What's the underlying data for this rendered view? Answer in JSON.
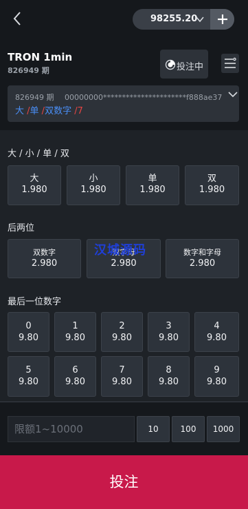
{
  "topbar": {
    "balance": "98255.20",
    "plus_label": "+"
  },
  "header": {
    "title": "TRON 1min",
    "period": "826949 期",
    "bet_status": "投注中"
  },
  "result": {
    "period": "826949 期",
    "hash": "00000000**********************f888ae37",
    "size": "大",
    "sep1": " /",
    "oddeven": "单",
    "sep2": " /",
    "type": "双数字",
    "sep3": " /",
    "digit": "7"
  },
  "sections": {
    "bigsmall_title": "大 / 小 / 单 / 双",
    "last2_title": "后两位",
    "lastdigit_title": "最后一位数字"
  },
  "bigsmall": [
    {
      "name": "大",
      "odds": "1.980"
    },
    {
      "name": "小",
      "odds": "1.980"
    },
    {
      "name": "单",
      "odds": "1.980"
    },
    {
      "name": "双",
      "odds": "1.980"
    }
  ],
  "last2": [
    {
      "name": "双数字",
      "odds": "2.980"
    },
    {
      "name": "双字母",
      "odds": "2.980"
    },
    {
      "name": "数字和字母",
      "odds": "2.980"
    }
  ],
  "digits": [
    {
      "name": "0",
      "odds": "9.80"
    },
    {
      "name": "1",
      "odds": "9.80"
    },
    {
      "name": "2",
      "odds": "9.80"
    },
    {
      "name": "3",
      "odds": "9.80"
    },
    {
      "name": "4",
      "odds": "9.80"
    },
    {
      "name": "5",
      "odds": "9.80"
    },
    {
      "name": "6",
      "odds": "9.80"
    },
    {
      "name": "7",
      "odds": "9.80"
    },
    {
      "name": "8",
      "odds": "9.80"
    },
    {
      "name": "9",
      "odds": "9.80"
    }
  ],
  "watermark": "汉城源码",
  "bet_input": {
    "placeholder": "限额1~10000"
  },
  "quick_amounts": [
    "10",
    "100",
    "1000"
  ],
  "submit_label": "投注",
  "colors": {
    "background": "#1e2227",
    "panel": "#15181c",
    "cell": "#2d333b",
    "accent_submit": "#c8194a",
    "result_blue": "#4a8ef5",
    "result_red": "#e64543",
    "watermark": "#1f3fd6"
  },
  "icons": {
    "back": "chevron-left-icon",
    "balance_dropdown": "chevron-down-icon",
    "add": "plus-icon",
    "bet_status": "timer-icon",
    "menu": "menu-icon",
    "result_expand": "chevron-down-icon"
  }
}
